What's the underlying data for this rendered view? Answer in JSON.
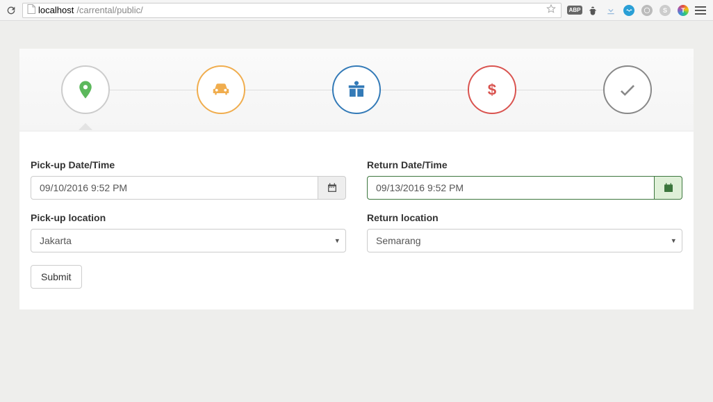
{
  "browser": {
    "url_host": "localhost",
    "url_path": "/carrental/public/",
    "toolbar_abp": "ABP"
  },
  "stepper": {
    "step1": "location",
    "step2": "car",
    "step3": "gift",
    "step4": "dollar",
    "step5": "check"
  },
  "form": {
    "pickup_date_label": "Pick-up Date/Time",
    "pickup_date_value": "09/10/2016 9:52 PM",
    "return_date_label": "Return Date/Time",
    "return_date_value": "09/13/2016 9:52 PM",
    "pickup_loc_label": "Pick-up location",
    "pickup_loc_value": "Jakarta",
    "return_loc_label": "Return location",
    "return_loc_value": "Semarang",
    "submit_label": "Submit"
  }
}
